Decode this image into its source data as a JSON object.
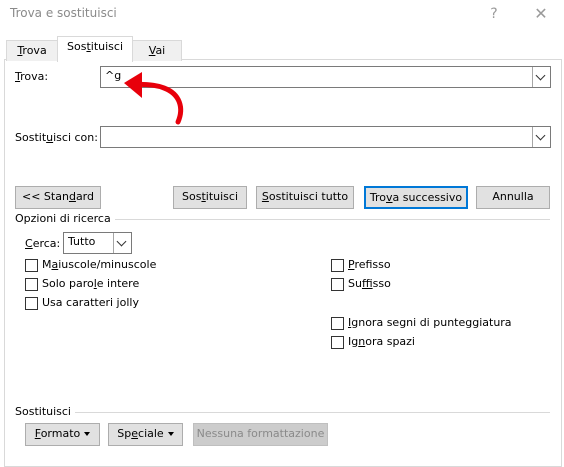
{
  "window": {
    "title": "Trova e sostituisci",
    "help": "?",
    "close": "✕"
  },
  "tabs": [
    {
      "label": "Trova",
      "active": false
    },
    {
      "label": "Sostituisci",
      "active": true
    },
    {
      "label": "Vai",
      "active": false
    }
  ],
  "find": {
    "label": "Trova:",
    "value": "^g"
  },
  "replace": {
    "label": "Sostituisci con:",
    "value": ""
  },
  "buttons": {
    "standard": "<< Standard",
    "replace": "Sostituisci",
    "replace_all": "Sostituisci tutto",
    "find_next": "Trova successivo",
    "cancel": "Annulla"
  },
  "search_options": {
    "section_label": "Opzioni di ricerca",
    "search_label": "Cerca:",
    "search_value": "Tutto",
    "left_checks": [
      {
        "label": "Maiuscole/minuscole",
        "checked": false
      },
      {
        "label": "Solo parole intere",
        "checked": false
      },
      {
        "label": "Usa caratteri jolly",
        "checked": false
      }
    ],
    "right_checks": [
      {
        "label": "Prefisso",
        "checked": false
      },
      {
        "label": "Suffisso",
        "checked": false
      },
      {
        "label": "Ignora segni di punteggiatura",
        "checked": false
      },
      {
        "label": "Ignora spazi",
        "checked": false
      }
    ]
  },
  "replace_section": {
    "label": "Sostituisci",
    "format": "Formato",
    "special": "Speciale",
    "no_format": "Nessuna formattazione"
  },
  "colors": {
    "accent": "#0078d7",
    "annotation_arrow": "#e8000b"
  }
}
